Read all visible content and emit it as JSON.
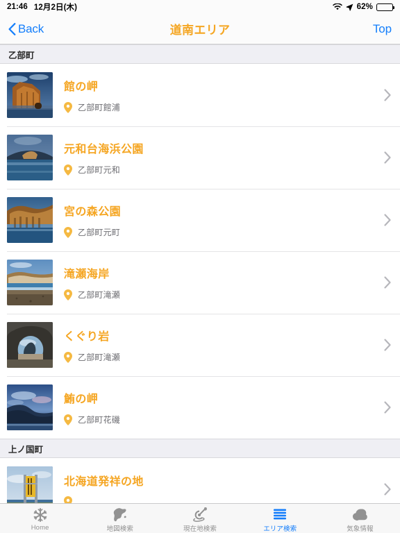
{
  "status_bar": {
    "time": "21:46",
    "date": "12月2日(木)",
    "wifi_icon": "wifi-icon",
    "location_icon": "location-arrow-icon",
    "battery_percent": "62%",
    "battery_level": 62,
    "battery_icon": "battery-icon"
  },
  "navbar": {
    "back_icon": "chevron-left-icon",
    "back_label": "Back",
    "title": "道南エリア",
    "top_label": "Top",
    "title_color": "#f5a623",
    "tint_color": "#147efb"
  },
  "sections": [
    {
      "header": "乙部町",
      "rows": [
        {
          "title": "館の岬",
          "address": "乙部町館浦",
          "thumb": "cliff-orange-thumbnail",
          "pin_icon": "map-pin-icon",
          "chevron_icon": "chevron-right-icon"
        },
        {
          "title": "元和台海浜公園",
          "address": "乙部町元和",
          "thumb": "sea-coast-thumbnail",
          "pin_icon": "map-pin-icon",
          "chevron_icon": "chevron-right-icon"
        },
        {
          "title": "宮の森公園",
          "address": "乙部町元町",
          "thumb": "rocky-cliff-thumbnail",
          "pin_icon": "map-pin-icon",
          "chevron_icon": "chevron-right-icon"
        },
        {
          "title": "滝瀬海岸",
          "address": "乙部町滝瀬",
          "thumb": "beach-thumbnail",
          "pin_icon": "map-pin-icon",
          "chevron_icon": "chevron-right-icon"
        },
        {
          "title": "くぐり岩",
          "address": "乙部町滝瀬",
          "thumb": "rock-arch-thumbnail",
          "pin_icon": "map-pin-icon",
          "chevron_icon": "chevron-right-icon"
        },
        {
          "title": "鮪の岬",
          "address": "乙部町花磯",
          "thumb": "dusk-cape-thumbnail",
          "pin_icon": "map-pin-icon",
          "chevron_icon": "chevron-right-icon"
        }
      ]
    },
    {
      "header": "上ノ国町",
      "rows": [
        {
          "title": "北海道発祥の地",
          "address": "",
          "thumb": "yellow-signpost-thumbnail",
          "pin_icon": "map-pin-icon",
          "chevron_icon": "chevron-right-icon"
        }
      ]
    }
  ],
  "tabbar": {
    "active_index": 3,
    "active_color": "#147efb",
    "inactive_color": "#929292",
    "items": [
      {
        "label": "Home",
        "icon": "snowflake-icon"
      },
      {
        "label": "地図検索",
        "icon": "hokkaido-map-icon"
      },
      {
        "label": "現在地検索",
        "icon": "radar-icon"
      },
      {
        "label": "エリア検索",
        "icon": "list-lines-icon"
      },
      {
        "label": "気象情報",
        "icon": "cloud-icon"
      }
    ]
  }
}
